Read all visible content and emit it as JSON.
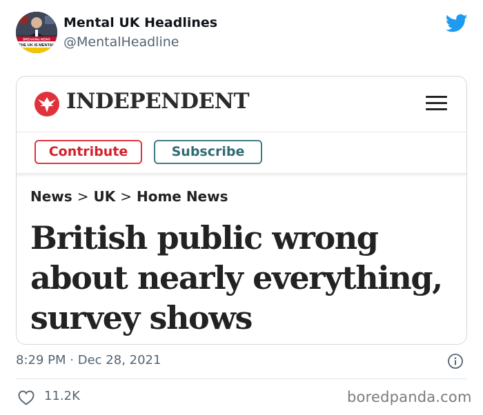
{
  "account": {
    "display_name": "Mental UK Headlines",
    "handle": "@MentalHeadline",
    "avatar_icon": "breaking-news-avatar",
    "avatar_banner_top": "BREAKING NEWS",
    "avatar_banner_main": "THE UK IS MENTAL"
  },
  "platform_icon": "twitter-bird-icon",
  "embed": {
    "publication": "INDEPENDENT",
    "logo_icon": "eagle-logo-icon",
    "menu_icon": "hamburger-menu-icon",
    "contribute_label": "Contribute",
    "subscribe_label": "Subscribe",
    "breadcrumb": [
      "News",
      "UK",
      "Home News"
    ],
    "breadcrumb_separator": ">",
    "headline_lines": [
      "British public wrong",
      "about nearly everything,",
      "survey shows"
    ]
  },
  "meta": {
    "time": "8:29 PM",
    "separator": "·",
    "date": "Dec 28, 2021",
    "info_icon": "info-icon"
  },
  "engagement": {
    "like_icon": "heart-icon",
    "likes": "11.2K"
  },
  "watermark": "boredpanda.com",
  "colors": {
    "twitter_blue": "#1d9bf0",
    "independent_red": "#e0323c",
    "subscribe_teal": "#3f7a80",
    "secondary_text": "#536471"
  }
}
